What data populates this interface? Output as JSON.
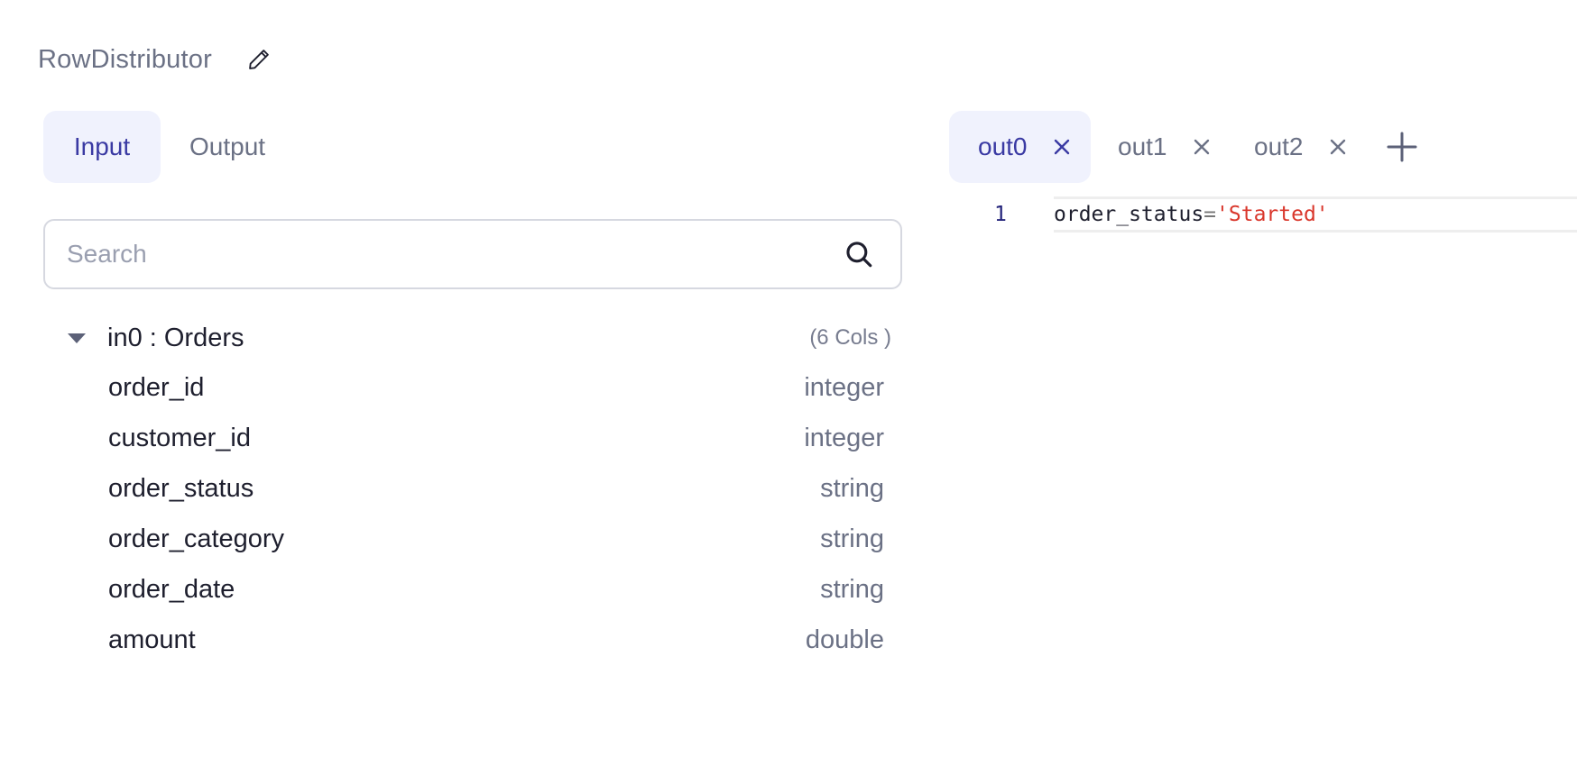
{
  "header": {
    "title": "RowDistributor",
    "edit_icon": "pencil-icon"
  },
  "left_tabs": [
    {
      "label": "Input",
      "active": true
    },
    {
      "label": "Output",
      "active": false
    }
  ],
  "search": {
    "placeholder": "Search",
    "value": "",
    "icon": "search-icon"
  },
  "schema": {
    "source": "in0 : Orders",
    "count_label": "(6 Cols )",
    "expanded": true,
    "columns": [
      {
        "name": "order_id",
        "type": "integer"
      },
      {
        "name": "customer_id",
        "type": "integer"
      },
      {
        "name": "order_status",
        "type": "string"
      },
      {
        "name": "order_category",
        "type": "string"
      },
      {
        "name": "order_date",
        "type": "string"
      },
      {
        "name": "amount",
        "type": "double"
      }
    ]
  },
  "output_tabs": [
    {
      "label": "out0",
      "active": true
    },
    {
      "label": "out1",
      "active": false
    },
    {
      "label": "out2",
      "active": false
    }
  ],
  "editor": {
    "line_number": "1",
    "code_identifier": "order_status",
    "code_operator": "=",
    "code_string": "'Started'"
  },
  "colors": {
    "accent": "#3a3aa3",
    "active_tab_bg": "#f0f2fd",
    "muted_text": "#6b7185",
    "string_literal": "#d9362b"
  }
}
